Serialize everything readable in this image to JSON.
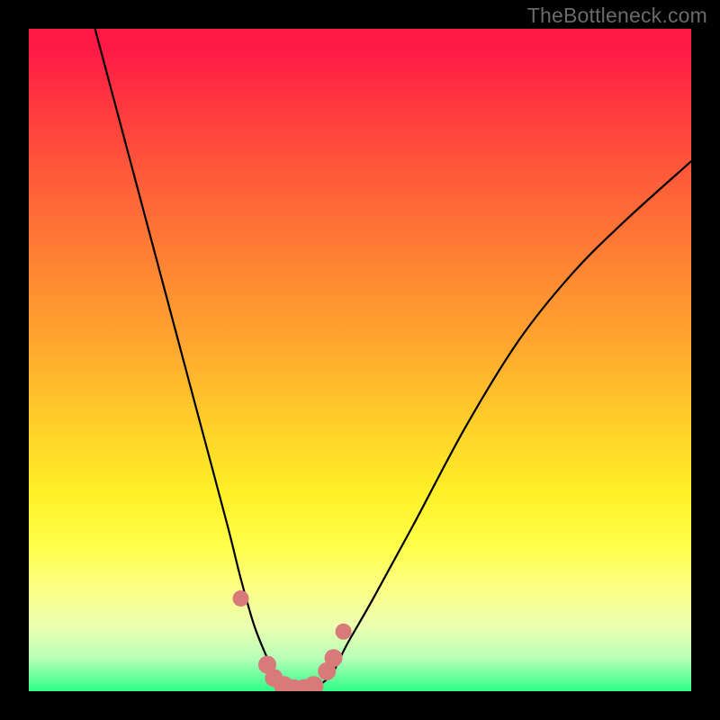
{
  "watermark": "TheBottleneck.com",
  "colors": {
    "frame": "#000000",
    "curve": "#000000",
    "dot": "#d97a7a",
    "gradient_top": "#ff1a46",
    "gradient_bottom": "#2eff88"
  },
  "chart_data": {
    "type": "line",
    "title": "",
    "xlabel": "",
    "ylabel": "",
    "xlim": [
      0,
      100
    ],
    "ylim": [
      0,
      100
    ],
    "annotations": [
      "TheBottleneck.com"
    ],
    "description": "V-shaped bottleneck curve descending from upper-left, reaching a minimum near x≈40, then rising toward upper-right. Lower values (near bottom/green) indicate balanced configuration; higher values (red) indicate bottleneck.",
    "series": [
      {
        "name": "bottleneck-curve",
        "x": [
          10,
          14,
          18,
          22,
          26,
          30,
          32,
          34,
          36,
          38,
          40,
          42,
          44,
          46,
          48,
          52,
          58,
          66,
          74,
          82,
          90,
          100
        ],
        "y": [
          100,
          85,
          70,
          55,
          40,
          25,
          17,
          10,
          5,
          1,
          0,
          0,
          1,
          3,
          7,
          14,
          25,
          40,
          53,
          63,
          71,
          80
        ]
      }
    ],
    "markers": {
      "name": "highlighted-dots",
      "x": [
        32,
        36,
        37,
        38.5,
        40,
        41.5,
        43,
        45,
        46,
        47.5
      ],
      "y": [
        14,
        4,
        2,
        0.8,
        0.3,
        0.3,
        0.8,
        3,
        5,
        9
      ]
    }
  }
}
